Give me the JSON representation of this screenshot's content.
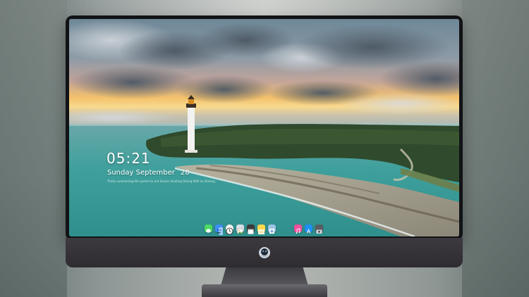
{
  "lock_screen": {
    "time": "05:21",
    "weekday_month": "Sunday September",
    "day": "28",
    "subline": "Trinity summoning life system to ant Slavics Vaulting Strong Wild on Shining"
  },
  "dock": {
    "apps": [
      {
        "name": "messages-icon",
        "color": "#4cd964"
      },
      {
        "name": "finder-icon",
        "color": "#3d8df5"
      },
      {
        "name": "clock-icon",
        "color": "#f2f2f2"
      },
      {
        "name": "photos-icon",
        "color": "#d8dfe6"
      },
      {
        "name": "clapper-icon",
        "color": "#3a3a3a"
      },
      {
        "name": "notes-icon",
        "color": "#ffd84d"
      },
      {
        "name": "preview-icon",
        "color": "#9fc3e6"
      },
      {
        "name": "music-icon",
        "color": "#f0509f"
      },
      {
        "name": "app-store-icon",
        "color": "#1f8ff4"
      },
      {
        "name": "camera-icon",
        "color": "#5a5d63"
      }
    ]
  },
  "colors": {
    "bezel": "#121316",
    "chin": "#353238",
    "sea": "#3aa7a1",
    "sunset": "#f2b24a"
  }
}
